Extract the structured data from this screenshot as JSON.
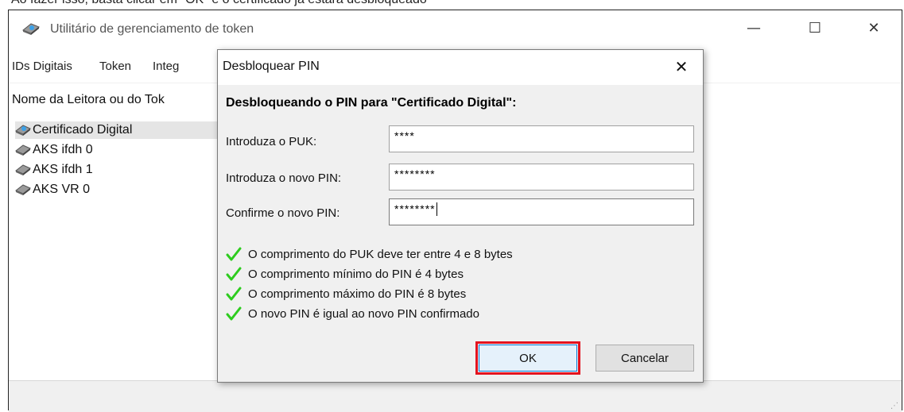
{
  "caption": {
    "text": "Ao fazer isso, basta clicar em \"OK\" e o certificado já estará desbloqueado"
  },
  "window": {
    "title": "Utilitário de gerenciamento de token",
    "icon": "token-reader-icon",
    "controls": {
      "minimize": "—",
      "maximize": "☐",
      "close": "✕"
    }
  },
  "menu": {
    "items": [
      "IDs Digitais",
      "Token",
      "Integ"
    ]
  },
  "list": {
    "header": "Nome da Leitora ou do Tok",
    "items": [
      {
        "label": "Certificado Digital",
        "icon": "token-connected-icon",
        "selected": true
      },
      {
        "label": "AKS ifdh 0",
        "icon": "token-reader-icon",
        "selected": false
      },
      {
        "label": "AKS ifdh 1",
        "icon": "token-reader-icon",
        "selected": false
      },
      {
        "label": "AKS VR 0",
        "icon": "token-reader-icon",
        "selected": false
      }
    ]
  },
  "dialog": {
    "title": "Desbloquear PIN",
    "close": "✕",
    "heading": "Desbloqueando o PIN para \"Certificado Digital\":",
    "fields": [
      {
        "label": "Introduza o PUK:",
        "value": "****"
      },
      {
        "label": "Introduza o novo PIN:",
        "value": "********"
      },
      {
        "label": "Confirme o novo PIN:",
        "value": "********"
      }
    ],
    "rules": [
      "O comprimento do PUK deve ter entre 4 e 8 bytes",
      "O comprimento mínimo do PIN é 4 bytes",
      "O comprimento máximo do PIN é 8 bytes",
      "O novo PIN é igual ao novo PIN confirmado"
    ],
    "ok_label": "OK",
    "cancel_label": "Cancelar",
    "colors": {
      "check": "#2ecc1f",
      "highlight": "#e3131f"
    }
  }
}
